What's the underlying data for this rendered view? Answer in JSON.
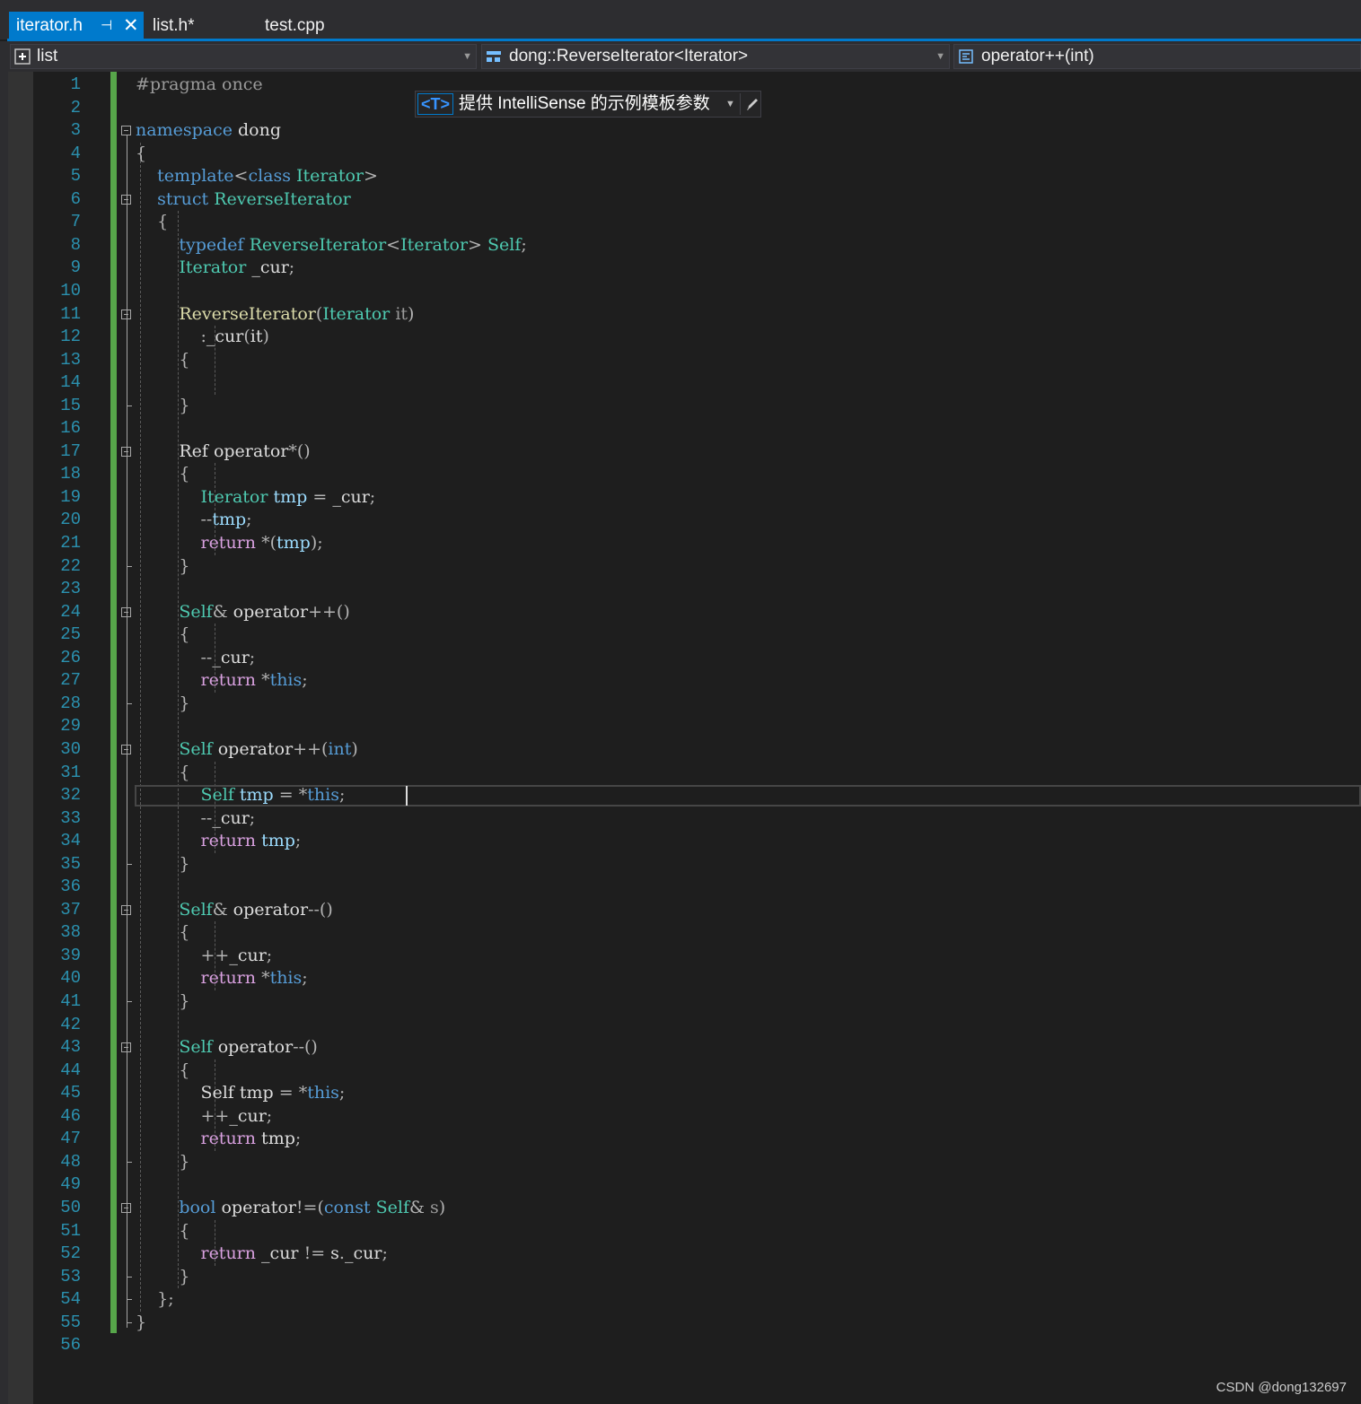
{
  "tabs": [
    {
      "label": "iterator.h",
      "active": true
    },
    {
      "label": "list.h*",
      "active": false
    },
    {
      "label": "test.cpp",
      "active": false
    }
  ],
  "navbar": {
    "project": "list",
    "scope": "dong::ReverseIterator<Iterator>",
    "member": "operator++(int)"
  },
  "template_bar": {
    "icon_text": "<T>",
    "label": "提供 IntelliSense 的示例模板参数"
  },
  "editor": {
    "lines": [
      "#pragma once",
      "",
      "namespace dong",
      "{",
      "    template<class Iterator>",
      "    struct ReverseIterator",
      "    {",
      "        typedef ReverseIterator<Iterator> Self;",
      "        Iterator _cur;",
      "",
      "        ReverseIterator(Iterator it)",
      "            :_cur(it)",
      "        {",
      "",
      "        }",
      "",
      "        Ref operator*()",
      "        {",
      "            Iterator tmp = _cur;",
      "            --tmp;",
      "            return *(tmp);",
      "        }",
      "",
      "        Self& operator++()",
      "        {",
      "            --_cur;",
      "            return *this;",
      "        }",
      "",
      "        Self operator++(int)",
      "        {",
      "            Self tmp = *this;",
      "            --_cur;",
      "            return tmp;",
      "        }",
      "",
      "        Self& operator--()",
      "        {",
      "            ++_cur;",
      "            return *this;",
      "        }",
      "",
      "        Self operator--()",
      "        {",
      "            Self tmp = *this;",
      "            ++_cur;",
      "            return tmp;",
      "        }",
      "",
      "        bool operator!=(const Self& s)",
      "        {",
      "            return _cur != s._cur;",
      "        }",
      "    };",
      "}",
      ""
    ],
    "current_line": 32
  },
  "watermark": "CSDN @dong132697",
  "colors": {
    "accent": "#007acc",
    "keyword": "#569cd6",
    "type": "#4ec9b0",
    "function": "#dcdcaa",
    "control": "#d8a0df",
    "line_number": "#2b91af",
    "change_bar": "#57a64a"
  }
}
